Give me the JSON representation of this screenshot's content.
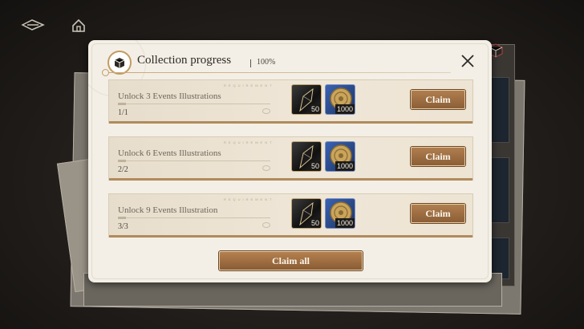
{
  "header": {
    "back_icon": "back-arrow-icon",
    "home_icon": "home-icon"
  },
  "panel": {
    "title": "Collection progress",
    "percent": "100%",
    "title_icon": "collection-box-icon",
    "close_icon": "close-icon"
  },
  "tasks": [
    {
      "tag": "REQUIREMENT",
      "label": "Unlock 3 Events Illustrations",
      "progress": "1/1",
      "rewards": [
        {
          "icon": "dark-crystal-shard-icon",
          "qty": "50"
        },
        {
          "icon": "gold-coin-icon",
          "qty": "1000"
        }
      ],
      "button": "Claim"
    },
    {
      "tag": "REQUIREMENT",
      "label": "Unlock 6 Events Illustrations",
      "progress": "2/2",
      "rewards": [
        {
          "icon": "dark-crystal-shard-icon",
          "qty": "50"
        },
        {
          "icon": "gold-coin-icon",
          "qty": "1000"
        }
      ],
      "button": "Claim"
    },
    {
      "tag": "REQUIREMENT",
      "label": "Unlock 9 Events Illustration",
      "progress": "3/3",
      "rewards": [
        {
          "icon": "dark-crystal-shard-icon",
          "qty": "50"
        },
        {
          "icon": "gold-coin-icon",
          "qty": "1000"
        }
      ],
      "button": "Claim"
    }
  ],
  "footer": {
    "claim_all": "Claim all"
  },
  "colors": {
    "panel_bg": "#f3efe6",
    "button_brown": "#9b6b40",
    "accent_gold": "#c39b61"
  }
}
